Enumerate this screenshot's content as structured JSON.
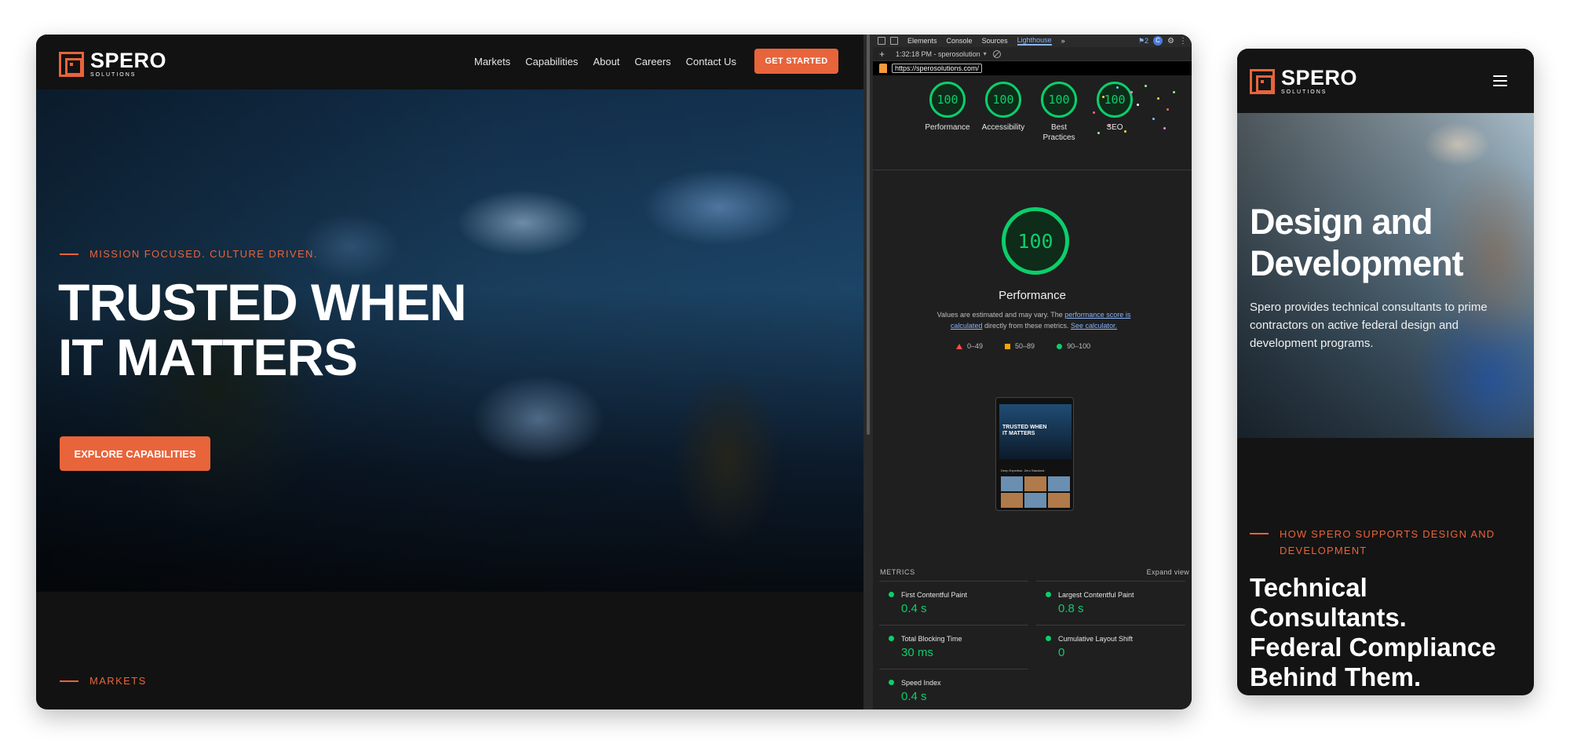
{
  "brand": {
    "name": "SPERO",
    "sub": "SOLUTIONS",
    "accent": "#e8643a"
  },
  "desktop": {
    "nav": {
      "links": [
        "Markets",
        "Capabilities",
        "About",
        "Careers",
        "Contact Us"
      ],
      "cta": "GET STARTED"
    },
    "hero": {
      "tagline": "MISSION FOCUSED. CULTURE DRIVEN.",
      "title_line1": "TRUSTED WHEN",
      "title_line2": "IT MATTERS",
      "cta": "EXPLORE CAPABILITIES"
    },
    "markets_label": "MARKETS"
  },
  "devtools": {
    "tabs": [
      "Elements",
      "Console",
      "Sources",
      "Lighthouse"
    ],
    "active_tab": "Lighthouse",
    "issues": "2",
    "avatar": "C",
    "run_label": "1:32:18 PM - sperosolution",
    "url": "https://sperosolutions.com/",
    "scores": [
      {
        "label": "Performance",
        "value": "100"
      },
      {
        "label": "Accessibility",
        "value": "100"
      },
      {
        "label": "Best Practices",
        "value": "100"
      },
      {
        "label": "SEO",
        "value": "100"
      }
    ],
    "performance": {
      "score": "100",
      "title": "Performance",
      "desc_prefix": "Values are estimated and may vary. The",
      "desc_link1": "performance score is calculated",
      "desc_middle": "directly from these metrics.",
      "desc_link2": "See calculator."
    },
    "legend": {
      "low": "0–49",
      "mid": "50–89",
      "high": "90–100"
    },
    "thumbnail": {
      "title_line1": "TRUSTED WHEN",
      "title_line2": "IT MATTERS",
      "caption": "Deep Expertise. Zero Standard."
    },
    "metrics_label": "METRICS",
    "expand_label": "Expand view",
    "metrics": [
      {
        "name": "First Contentful Paint",
        "value": "0.4 s"
      },
      {
        "name": "Largest Contentful Paint",
        "value": "0.8 s"
      },
      {
        "name": "Total Blocking Time",
        "value": "30 ms"
      },
      {
        "name": "Cumulative Layout Shift",
        "value": "0"
      },
      {
        "name": "Speed Index",
        "value": "0.4 s"
      }
    ],
    "colors": {
      "pass": "#0cce6b",
      "average": "#ffa400",
      "fail": "#ff4e42",
      "link": "#8ab4f8"
    }
  },
  "mobile": {
    "hero_title_line1": "Design and",
    "hero_title_line2": "Development",
    "hero_desc": "Spero provides technical consultants to prime contractors on active federal design and development programs.",
    "subheading": "HOW SPERO SUPPORTS DESIGN AND DEVELOPMENT",
    "big_heading_line1": "Technical",
    "big_heading_line2": "Consultants.",
    "big_heading_line3": "Federal Compliance",
    "big_heading_line4": "Behind Them."
  }
}
